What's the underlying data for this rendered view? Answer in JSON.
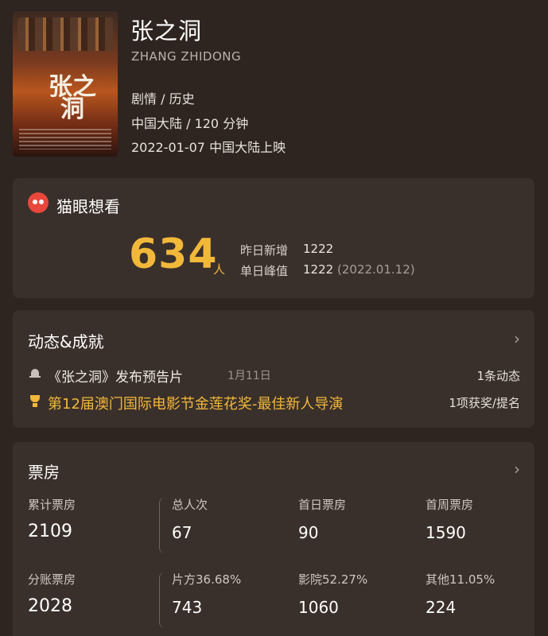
{
  "movie": {
    "poster_title": "张之洞",
    "title": "张之洞",
    "title_en": "ZHANG ZHIDONG",
    "genre": "剧情 / 历史",
    "region_duration": "中国大陆 / 120 分钟",
    "release": "2022-01-07 中国大陆上映"
  },
  "want": {
    "label": "猫眼想看",
    "count": "634",
    "unit": "人",
    "yesterday_label": "昨日新增",
    "yesterday_value": "1222",
    "peak_label": "单日峰值",
    "peak_value": "1222",
    "peak_date": "(2022.01.12)"
  },
  "news": {
    "title": "动态&成就",
    "chevron": "›",
    "item_text": "《张之洞》发布预告片",
    "item_date": "1月11日",
    "item_count": "1条动态",
    "award_text": "第12届澳门国际电影节金莲花奖-最佳新人导演",
    "award_count": "1项获奖/提名"
  },
  "box_office": {
    "title": "票房",
    "chevron": "›",
    "row1": [
      {
        "label": "累计票房",
        "value": "2109"
      },
      {
        "label": "总人次",
        "value": "67"
      },
      {
        "label": "首日票房",
        "value": "90"
      },
      {
        "label": "首周票房",
        "value": "1590"
      }
    ],
    "row2": [
      {
        "label": "分账票房",
        "value": "2028"
      },
      {
        "label": "片方36.68%",
        "value": "743"
      },
      {
        "label": "影院52.27%",
        "value": "1060"
      },
      {
        "label": "其他11.05%",
        "value": "224"
      }
    ]
  }
}
